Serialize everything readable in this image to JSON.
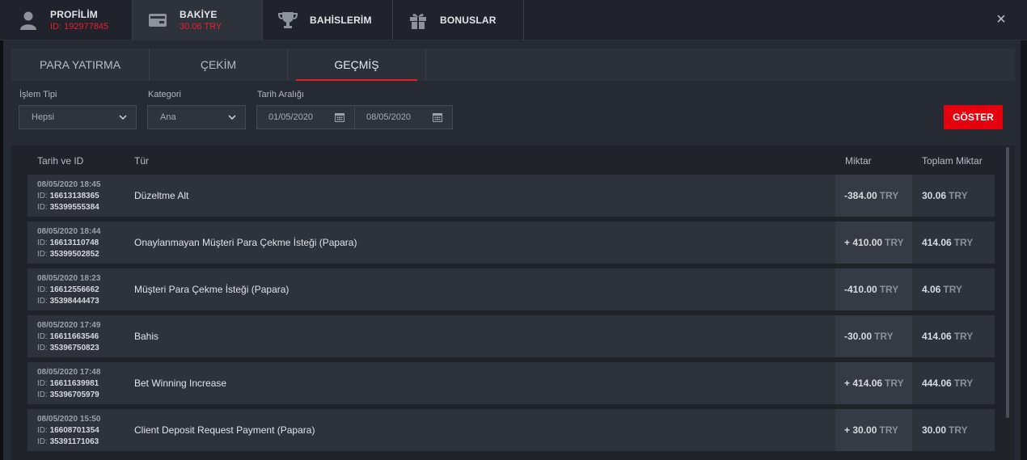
{
  "topbar": {
    "tabs": [
      {
        "label": "PROFİLİM",
        "sub": "ID: 192977845",
        "icon": "user-icon"
      },
      {
        "label": "BAKİYE",
        "sub": "30.06 TRY",
        "icon": "wallet-icon"
      },
      {
        "label": "BAHİSLERİM",
        "sub": "",
        "icon": "trophy-icon"
      },
      {
        "label": "BONUSLAR",
        "sub": "",
        "icon": "gift-icon"
      }
    ],
    "close": "×"
  },
  "subtabs": [
    {
      "label": "PARA YATIRMA"
    },
    {
      "label": "ÇEKİM"
    },
    {
      "label": "GEÇMİŞ"
    }
  ],
  "filters": {
    "type_label": "İşlem Tipi",
    "type_value": "Hepsi",
    "category_label": "Kategori",
    "category_value": "Ana",
    "date_label": "Tarih Aralığı",
    "date_from": "01/05/2020",
    "date_to": "08/05/2020",
    "show_button": "GÖSTER"
  },
  "table": {
    "headers": {
      "date_id": "Tarih ve ID",
      "type": "Tür",
      "amount": "Miktar",
      "total": "Toplam Miktar"
    },
    "id_prefix": "ID:",
    "currency": "TRY",
    "rows": [
      {
        "date": "08/05/2020 18:45",
        "id1": "16613138365",
        "id2": "35399555384",
        "type": "Düzeltme Alt",
        "amount": "-384.00",
        "total": "30.06"
      },
      {
        "date": "08/05/2020 18:44",
        "id1": "16613110748",
        "id2": "35399502852",
        "type": "Onaylanmayan Müşteri Para Çekme İsteği (Papara)",
        "amount": "+ 410.00",
        "total": "414.06"
      },
      {
        "date": "08/05/2020 18:23",
        "id1": "16612556662",
        "id2": "35398444473",
        "type": "Müşteri Para Çekme İsteği (Papara)",
        "amount": "-410.00",
        "total": "4.06"
      },
      {
        "date": "08/05/2020 17:49",
        "id1": "16611663546",
        "id2": "35396750823",
        "type": "Bahis",
        "amount": "-30.00",
        "total": "414.06"
      },
      {
        "date": "08/05/2020 17:48",
        "id1": "16611639981",
        "id2": "35396705979",
        "type": "Bet Winning Increase",
        "amount": "+ 414.06",
        "total": "444.06"
      },
      {
        "date": "08/05/2020 15:50",
        "id1": "16608701354",
        "id2": "35391171063",
        "type": "Client Deposit Request Payment (Papara)",
        "amount": "+ 30.00",
        "total": "30.00"
      }
    ]
  }
}
